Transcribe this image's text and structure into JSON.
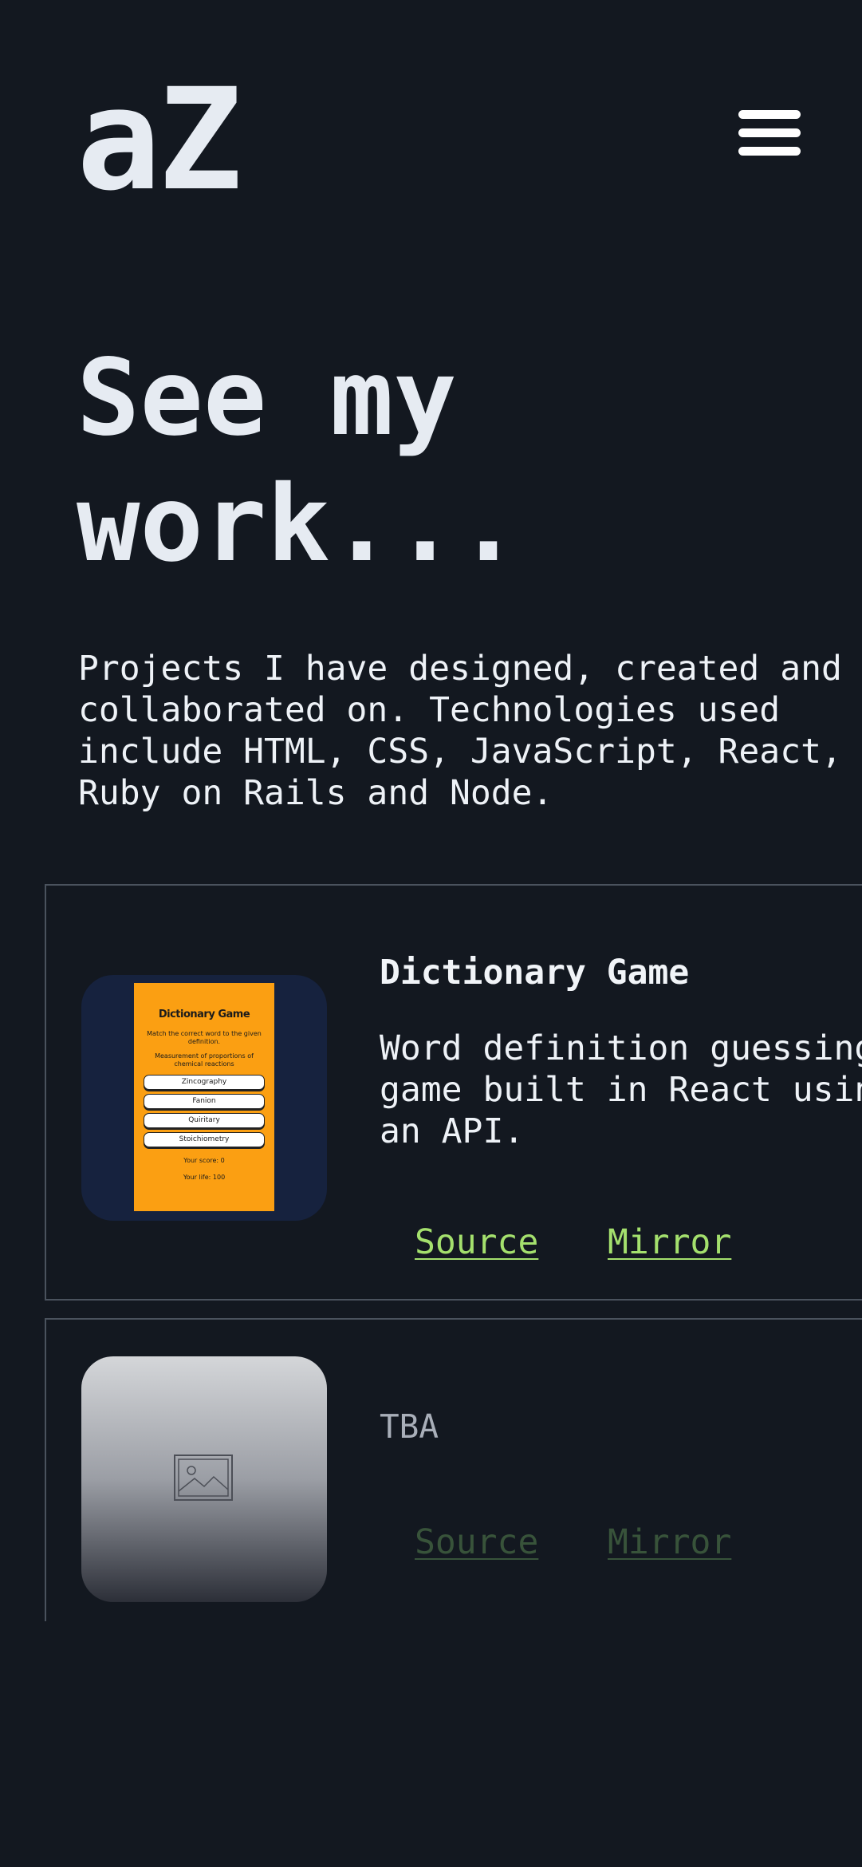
{
  "header": {
    "logo": "aZ",
    "menu_icon": "hamburger-menu-icon"
  },
  "hero": {
    "title": "See my\nwork...",
    "intro": "Projects I have designed, created and collaborated on. Technologies used include HTML, CSS, JavaScript, React, Ruby on Rails and Node."
  },
  "projects": [
    {
      "title": "Dictionary Game",
      "description": "Word definition guessing game built in React using an API.",
      "source_label": "Source",
      "mirror_label": "Mirror",
      "thumbnail": {
        "title": "Dictionary Game",
        "instruction": "Match the correct word to the given definition.",
        "clue": "Measurement of proportions of chemical reactions",
        "options": [
          "Zincography",
          "Fanion",
          "Quiritary",
          "Stoichiometry"
        ],
        "score": "Your score: 0",
        "life": "Your life: 100"
      }
    },
    {
      "title": "TBA",
      "source_label": "Source",
      "mirror_label": "Mirror",
      "thumbnail_icon": "image-placeholder-icon"
    }
  ],
  "colors": {
    "background": "#131820",
    "text": "#e6ebf2",
    "link": "#a4e06d",
    "link_disabled": "#38533a",
    "card_border": "#4a525d",
    "thumbnail_bg": "#16223e",
    "game_orange": "#fb9f12"
  }
}
